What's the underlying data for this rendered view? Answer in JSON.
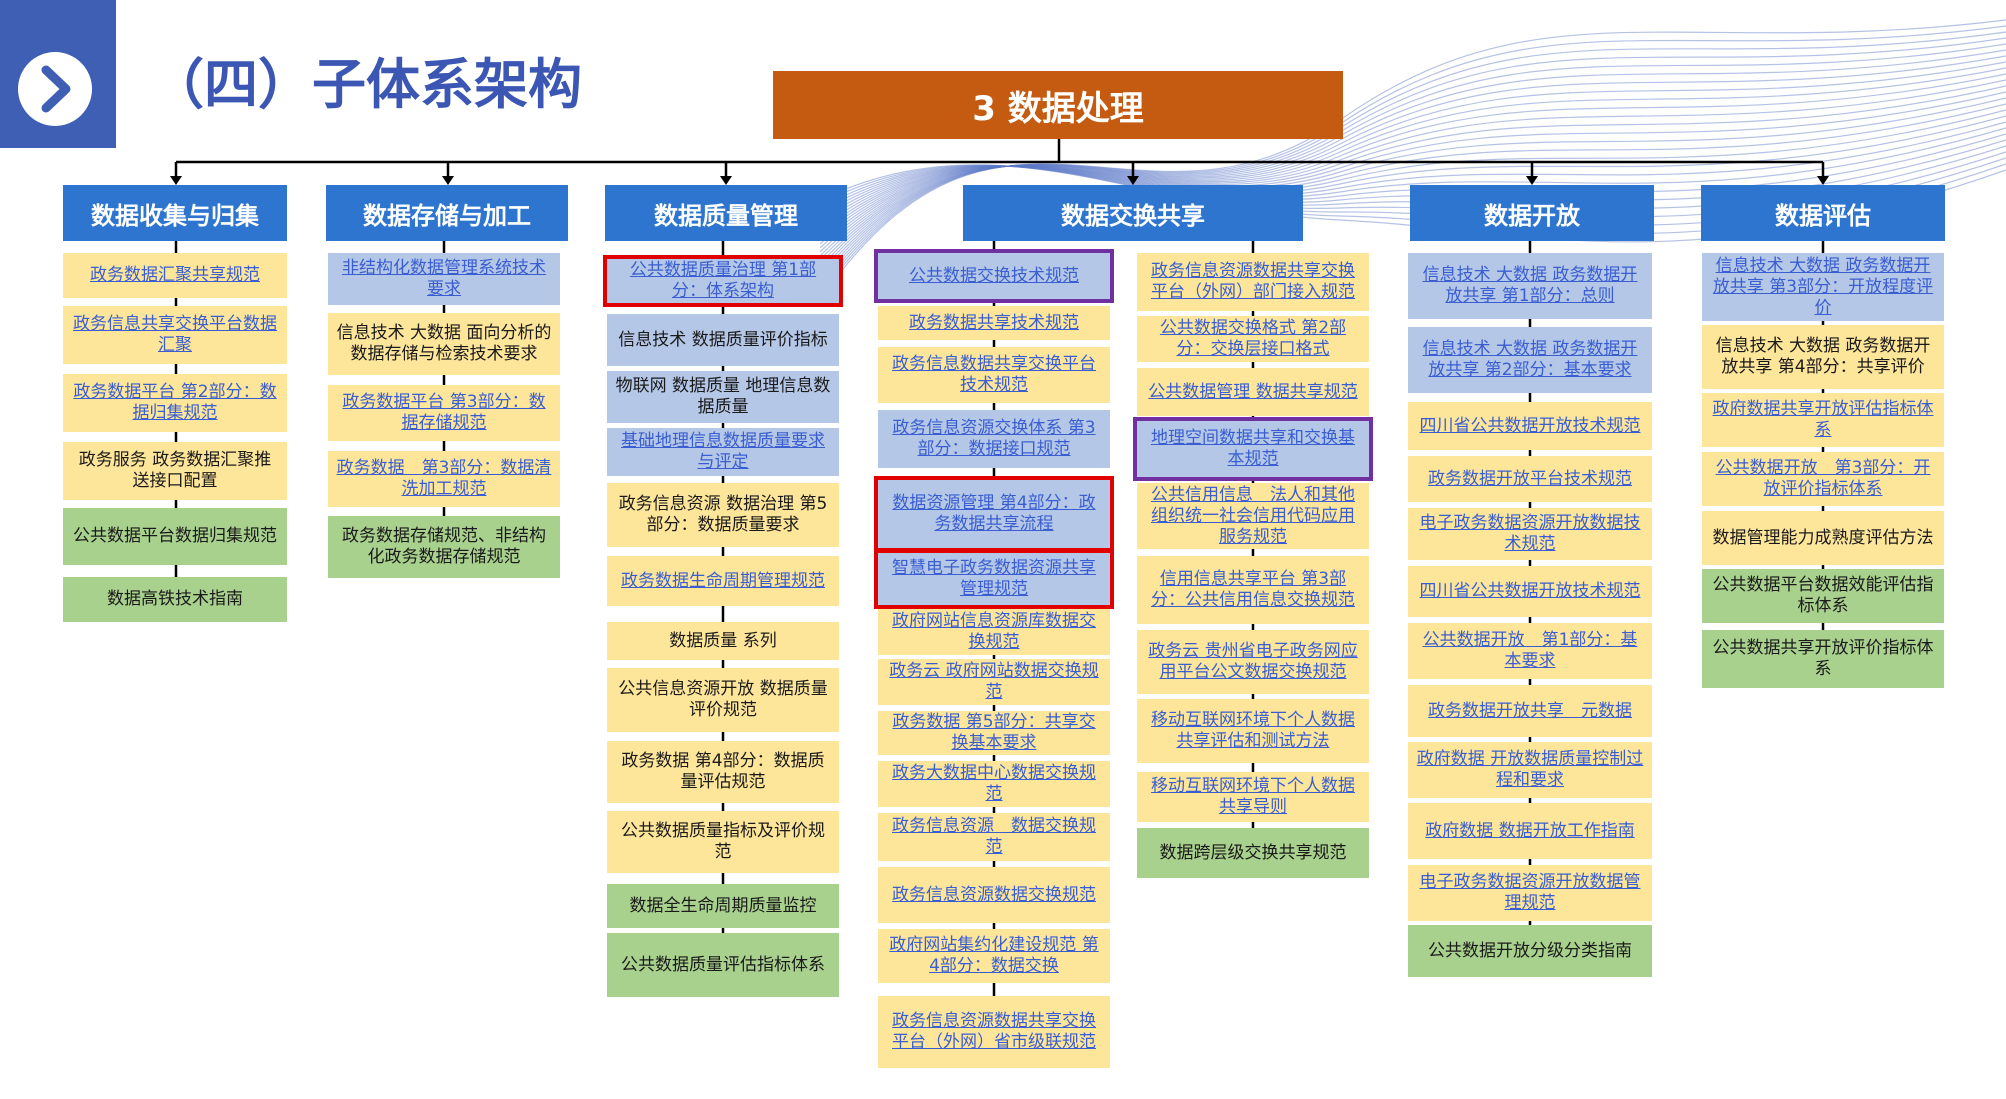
{
  "header": {
    "title": "（四）子体系架构",
    "icon": "chevron-right-icon",
    "accent_color": "#3f5fb5"
  },
  "root": {
    "label": "3 数据处理",
    "color": "#c55a11"
  },
  "colors": {
    "category": "#2e75d0",
    "yellow": "#fde59a",
    "blue": "#b4c7e7",
    "green": "#a9d18e",
    "highlight_red": "#e00000",
    "highlight_purple": "#7030a0"
  },
  "categories": [
    {
      "title": "数据收集与归集",
      "items": [
        {
          "text": "政务数据汇聚共享规范",
          "color": "yellow",
          "link": true
        },
        {
          "text": "政务信息共享交换平台数据汇聚",
          "color": "yellow",
          "link": true
        },
        {
          "text": "政务数据平台 第2部分：数据归集规范",
          "color": "yellow",
          "link": true
        },
        {
          "text": "政务服务 政务数据汇聚推送接口配置",
          "color": "yellow",
          "link": false
        },
        {
          "text": "公共数据平台数据归集规范",
          "color": "green",
          "link": false
        },
        {
          "text": "数据高铁技术指南",
          "color": "green",
          "link": false
        }
      ]
    },
    {
      "title": "数据存储与加工",
      "items": [
        {
          "text": "非结构化数据管理系统技术要求",
          "color": "blue",
          "link": true
        },
        {
          "text": "信息技术 大数据 面向分析的数据存储与检索技术要求",
          "color": "yellow",
          "link": false
        },
        {
          "text": "政务数据平台 第3部分：数据存储规范",
          "color": "yellow",
          "link": true
        },
        {
          "text": "政务数据　第3部分：数据清洗加工规范",
          "color": "yellow",
          "link": true
        },
        {
          "text": "政务数据存储规范、非结构化政务数据存储规范",
          "color": "green",
          "link": false
        }
      ]
    },
    {
      "title": "数据质量管理",
      "items": [
        {
          "text": "公共数据质量治理 第1部分：体系架构",
          "color": "blue",
          "link": true,
          "highlight": "red"
        },
        {
          "text": "信息技术 数据质量评价指标",
          "color": "blue",
          "link": false
        },
        {
          "text": "物联网 数据质量 地理信息数据质量",
          "color": "blue",
          "link": false
        },
        {
          "text": "基础地理信息数据质量要求与评定",
          "color": "blue",
          "link": true
        },
        {
          "text": "政务信息资源 数据治理 第5部分：数据质量要求",
          "color": "yellow",
          "link": false
        },
        {
          "text": "政务数据生命周期管理规范",
          "color": "yellow",
          "link": true
        },
        {
          "text": "数据质量 系列",
          "color": "yellow",
          "link": false
        },
        {
          "text": "公共信息资源开放 数据质量评价规范",
          "color": "yellow",
          "link": false
        },
        {
          "text": "政务数据 第4部分：数据质量评估规范",
          "color": "yellow",
          "link": false
        },
        {
          "text": "公共数据质量指标及评价规范",
          "color": "yellow",
          "link": false
        },
        {
          "text": "数据全生命周期质量监控",
          "color": "green",
          "link": false
        },
        {
          "text": "公共数据质量评估指标体系",
          "color": "green",
          "link": false
        }
      ]
    },
    {
      "title": "数据交换共享",
      "items": [
        {
          "text": "公共数据交换技术规范",
          "color": "blue",
          "link": true,
          "highlight": "purple"
        },
        {
          "text": "政务数据共享技术规范",
          "color": "yellow",
          "link": true
        },
        {
          "text": "政务信息数据共享交换平台技术规范",
          "color": "yellow",
          "link": true
        },
        {
          "text": "政务信息资源交换体系 第3部分：数据接口规范",
          "color": "blue",
          "link": true
        },
        {
          "text": "数据资源管理 第4部分：政务数据共享流程",
          "color": "blue",
          "link": true,
          "highlight": "red"
        },
        {
          "text": "智慧电子政务数据资源共享管理规范",
          "color": "blue",
          "link": true,
          "highlight": "red"
        },
        {
          "text": "政府网站信息资源库数据交换规范",
          "color": "yellow",
          "link": true
        },
        {
          "text": "政务云 政府网站数据交换规范",
          "color": "yellow",
          "link": true
        },
        {
          "text": "政务数据 第5部分：共享交换基本要求",
          "color": "yellow",
          "link": true
        },
        {
          "text": "政务大数据中心数据交换规范",
          "color": "yellow",
          "link": true
        },
        {
          "text": "政务信息资源　数据交换规范",
          "color": "yellow",
          "link": true
        },
        {
          "text": "政务信息资源数据交换规范",
          "color": "yellow",
          "link": true
        },
        {
          "text": "政府网站集约化建设规范 第4部分：数据交换",
          "color": "yellow",
          "link": true
        },
        {
          "text": "政务信息资源数据共享交换平台（外网）省市级联规范",
          "color": "yellow",
          "link": true
        }
      ],
      "items_col2": [
        {
          "text": "政务信息资源数据共享交换平台（外网）部门接入规范",
          "color": "yellow",
          "link": true
        },
        {
          "text": "公共数据交换格式 第2部分：交换层接口格式",
          "color": "yellow",
          "link": true
        },
        {
          "text": "公共数据管理 数据共享规范",
          "color": "yellow",
          "link": true
        },
        {
          "text": "地理空间数据共享和交换基本规范",
          "color": "blue",
          "link": true,
          "highlight": "purple"
        },
        {
          "text": "公共信用信息　法人和其他组织统一社会信用代码应用服务规范",
          "color": "yellow",
          "link": true
        },
        {
          "text": "信用信息共享平台 第3部分：公共信用信息交换规范",
          "color": "yellow",
          "link": true
        },
        {
          "text": "政务云 贵州省电子政务网应用平台公文数据交换规范",
          "color": "yellow",
          "link": true
        },
        {
          "text": "移动互联网环境下个人数据共享评估和测试方法",
          "color": "yellow",
          "link": true
        },
        {
          "text": "移动互联网环境下个人数据共享导则",
          "color": "yellow",
          "link": true
        },
        {
          "text": "数据跨层级交换共享规范",
          "color": "green",
          "link": false
        }
      ]
    },
    {
      "title": "数据开放",
      "items": [
        {
          "text": "信息技术 大数据 政务数据开放共享 第1部分：总则",
          "color": "blue",
          "link": true
        },
        {
          "text": "信息技术 大数据 政务数据开放共享 第2部分：基本要求",
          "color": "blue",
          "link": true
        },
        {
          "text": "四川省公共数据开放技术规范",
          "color": "yellow",
          "link": true
        },
        {
          "text": "政务数据开放平台技术规范",
          "color": "yellow",
          "link": true
        },
        {
          "text": "电子政务数据资源开放数据技术规范",
          "color": "yellow",
          "link": true
        },
        {
          "text": "四川省公共数据开放技术规范",
          "color": "yellow",
          "link": true
        },
        {
          "text": "公共数据开放　第1部分：基本要求",
          "color": "yellow",
          "link": true
        },
        {
          "text": "政务数据开放共享　元数据",
          "color": "yellow",
          "link": true
        },
        {
          "text": "政府数据 开放数据质量控制过程和要求",
          "color": "yellow",
          "link": true
        },
        {
          "text": "政府数据 数据开放工作指南",
          "color": "yellow",
          "link": true
        },
        {
          "text": "电子政务数据资源开放数据管理规范",
          "color": "yellow",
          "link": true
        },
        {
          "text": "公共数据开放分级分类指南",
          "color": "green",
          "link": false
        }
      ]
    },
    {
      "title": "数据评估",
      "items": [
        {
          "text": "信息技术 大数据 政务数据开放共享 第3部分：开放程度评价",
          "color": "blue",
          "link": true
        },
        {
          "text": "信息技术 大数据 政务数据开放共享 第4部分：共享评价",
          "color": "yellow",
          "link": false
        },
        {
          "text": "政府数据共享开放评估指标体系",
          "color": "yellow",
          "link": true
        },
        {
          "text": "公共数据开放　第3部分：开放评价指标体系",
          "color": "yellow",
          "link": true
        },
        {
          "text": "数据管理能力成熟度评估方法",
          "color": "yellow",
          "link": false
        },
        {
          "text": "公共数据平台数据效能评估指标体系",
          "color": "green",
          "link": false
        },
        {
          "text": "公共数据共享开放评价指标体系",
          "color": "green",
          "link": false
        }
      ]
    }
  ]
}
